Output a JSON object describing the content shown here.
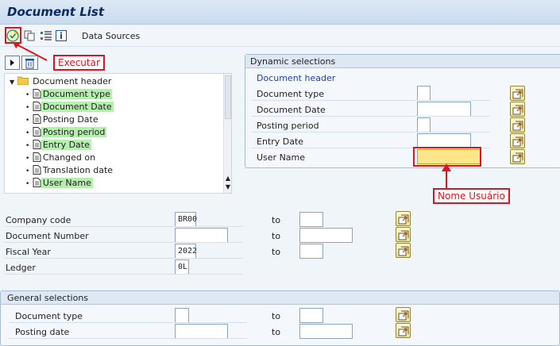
{
  "header": {
    "title": "Document List"
  },
  "toolbar": {
    "data_sources_label": "Data Sources"
  },
  "annotations": {
    "execute": "Executar",
    "user_name": "Nome Usuário"
  },
  "tree": {
    "root": "Document header",
    "items": [
      {
        "label": "Document type",
        "highlighted": true
      },
      {
        "label": "Document Date",
        "highlighted": true
      },
      {
        "label": "Posting Date",
        "highlighted": false
      },
      {
        "label": "Posting period",
        "highlighted": true
      },
      {
        "label": "Entry Date",
        "highlighted": true
      },
      {
        "label": "Changed on",
        "highlighted": false
      },
      {
        "label": "Translation date",
        "highlighted": false
      },
      {
        "label": "User Name",
        "highlighted": true
      }
    ]
  },
  "dynamic_selections": {
    "title": "Dynamic selections",
    "group": "Document header",
    "rows": [
      {
        "label": "Document type",
        "value": ""
      },
      {
        "label": "Document Date",
        "value": ""
      },
      {
        "label": "Posting period",
        "value": ""
      },
      {
        "label": "Entry Date",
        "value": ""
      },
      {
        "label": "User Name",
        "value": ""
      }
    ]
  },
  "selections": {
    "to_label": "to",
    "rows": [
      {
        "label": "Company code",
        "value": "BR00",
        "to": ""
      },
      {
        "label": "Document Number",
        "value": "",
        "to": ""
      },
      {
        "label": "Fiscal Year",
        "value": "2022",
        "to": ""
      },
      {
        "label": "Ledger",
        "value": "0L"
      }
    ]
  },
  "general_selections": {
    "title": "General selections",
    "rows": [
      {
        "label": "Document type",
        "value": "",
        "to": ""
      },
      {
        "label": "Posting date",
        "value": "",
        "to": ""
      }
    ]
  },
  "colors": {
    "highlight": "#b6eeb0",
    "callout": "#e0141e",
    "title": "#0b2a63",
    "user_name_field": "#fde68a"
  }
}
